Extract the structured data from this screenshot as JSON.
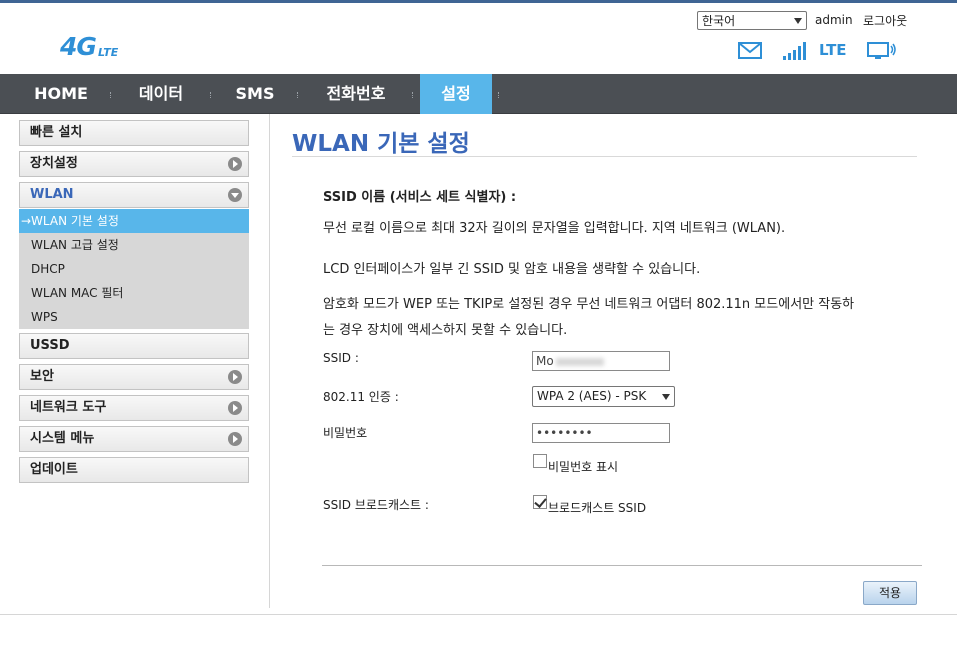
{
  "logo": {
    "main": "4G",
    "sub": "LTE"
  },
  "header": {
    "language_selected": "한국어",
    "user": "admin",
    "logout": "로그아웃",
    "lte_label": "LTE"
  },
  "icons": {
    "mail": "mail-icon",
    "signal": "signal-bars-icon",
    "device": "monitor-icon"
  },
  "nav": {
    "items": [
      {
        "label": "HOME"
      },
      {
        "label": "데이터"
      },
      {
        "label": "SMS"
      },
      {
        "label": "전화번호"
      },
      {
        "label": "설정"
      }
    ],
    "active_index": 4
  },
  "sidebar": {
    "items": [
      {
        "label": "빠른 설치"
      },
      {
        "label": "장치설정"
      },
      {
        "label": "WLAN"
      },
      {
        "label": "USSD"
      },
      {
        "label": "보안"
      },
      {
        "label": "네트워크 도구"
      },
      {
        "label": "시스템 메뉴"
      },
      {
        "label": "업데이트"
      }
    ],
    "wlan_sub": [
      {
        "label": "→WLAN 기본 설정"
      },
      {
        "label": "WLAN 고급 설정"
      },
      {
        "label": "DHCP"
      },
      {
        "label": "WLAN MAC 필터"
      },
      {
        "label": "WPS"
      }
    ]
  },
  "main": {
    "title": "WLAN 기본 설정",
    "ssid_heading": "SSID 이름 (서비스 세트 식별자) :",
    "desc1": "무선 로컬 이름으로 최대 32자 길이의 문자열을 입력합니다. 지역 네트워크 (WLAN).",
    "desc2": "LCD 인터페이스가 일부 긴 SSID 및 암호 내용을 생략할 수 있습니다.",
    "desc3a": "암호화 모드가 WEP 또는 TKIP로 설정된 경우 무선 네트워크 어댑터 802.11n 모드에서만 작동하",
    "desc3b": "는 경우 장치에 액세스하지 못할 수 있습니다.",
    "form": {
      "ssid_label": "SSID :",
      "ssid_value": "Mo",
      "auth_label": "802.11 인증 :",
      "auth_value": "WPA 2 (AES) - PSK",
      "password_label": "비밀번호",
      "password_value": "••••••••",
      "show_password_label": "비밀번호 표시",
      "show_password_checked": false,
      "broadcast_label": "SSID 브로드캐스트 :",
      "broadcast_option_label": "브로드캐스트 SSID",
      "broadcast_checked": true
    },
    "apply_label": "적용"
  },
  "colors": {
    "accent": "#58b6ea",
    "title_blue": "#3a67b8",
    "nav_bg": "#4b4f54",
    "logo_blue": "#2e8fd6"
  }
}
